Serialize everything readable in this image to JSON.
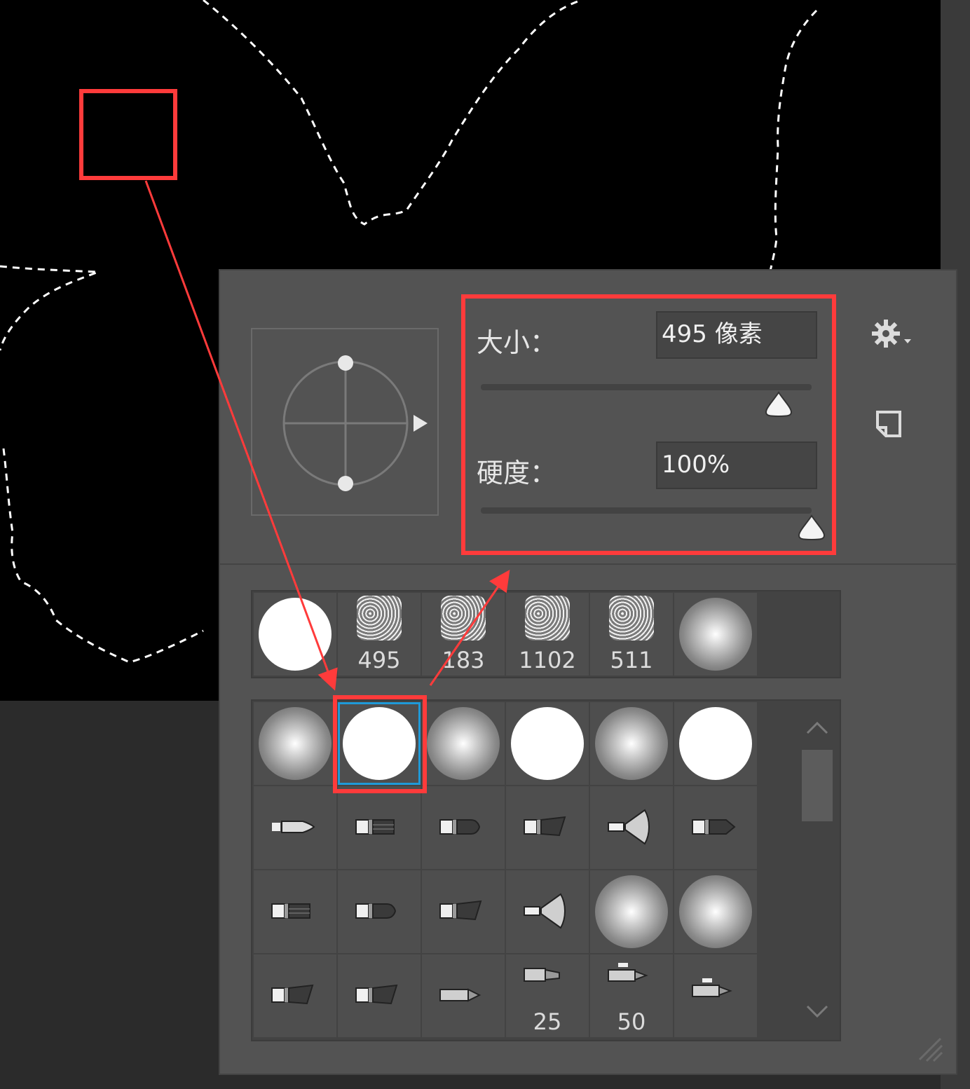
{
  "brush_panel": {
    "size": {
      "label": "大小：",
      "value": "495 像素",
      "slider_fraction": 0.9
    },
    "hardness": {
      "label": "硬度：",
      "value": "100%",
      "slider_fraction": 1.0
    },
    "icons": {
      "settings": "gear-icon",
      "new_preset": "new-preset-icon",
      "angle_preview": "brush-angle-roundness-icon"
    },
    "recent_brushes": [
      {
        "tip": "hard-round",
        "label": ""
      },
      {
        "tip": "textured",
        "label": "495"
      },
      {
        "tip": "textured",
        "label": "183"
      },
      {
        "tip": "textured",
        "label": "1102"
      },
      {
        "tip": "textured",
        "label": "511"
      },
      {
        "tip": "soft-round",
        "label": ""
      }
    ],
    "brush_grid": [
      [
        {
          "tip": "soft-round",
          "label": ""
        },
        {
          "tip": "hard-round",
          "label": "",
          "selected": true
        },
        {
          "tip": "soft-round",
          "label": ""
        },
        {
          "tip": "hard-round",
          "label": ""
        },
        {
          "tip": "soft-round",
          "label": ""
        },
        {
          "tip": "hard-round",
          "label": ""
        }
      ],
      [
        {
          "tip": "round-point-brush",
          "label": ""
        },
        {
          "tip": "flat-brush",
          "label": ""
        },
        {
          "tip": "round-blunt-brush",
          "label": ""
        },
        {
          "tip": "angled-brush",
          "label": ""
        },
        {
          "tip": "fan-brush",
          "label": ""
        },
        {
          "tip": "pointed-brush",
          "label": ""
        }
      ],
      [
        {
          "tip": "flat-brush-short",
          "label": ""
        },
        {
          "tip": "round-blunt-short",
          "label": ""
        },
        {
          "tip": "angled-short",
          "label": ""
        },
        {
          "tip": "fan-short",
          "label": ""
        },
        {
          "tip": "soft-round",
          "label": ""
        },
        {
          "tip": "soft-round",
          "label": ""
        }
      ],
      [
        {
          "tip": "angled-flat",
          "label": ""
        },
        {
          "tip": "angled-flat",
          "label": ""
        },
        {
          "tip": "pencil",
          "label": ""
        },
        {
          "tip": "airbrush",
          "label": "25"
        },
        {
          "tip": "airbrush-alt",
          "label": "50"
        },
        {
          "tip": "airbrush-alt",
          "label": ""
        }
      ]
    ]
  },
  "colors": {
    "annotation": "#ff3b3b",
    "selection_highlight": "#1f9ad8",
    "panel_background": "#535353",
    "canvas_background": "#000000"
  }
}
